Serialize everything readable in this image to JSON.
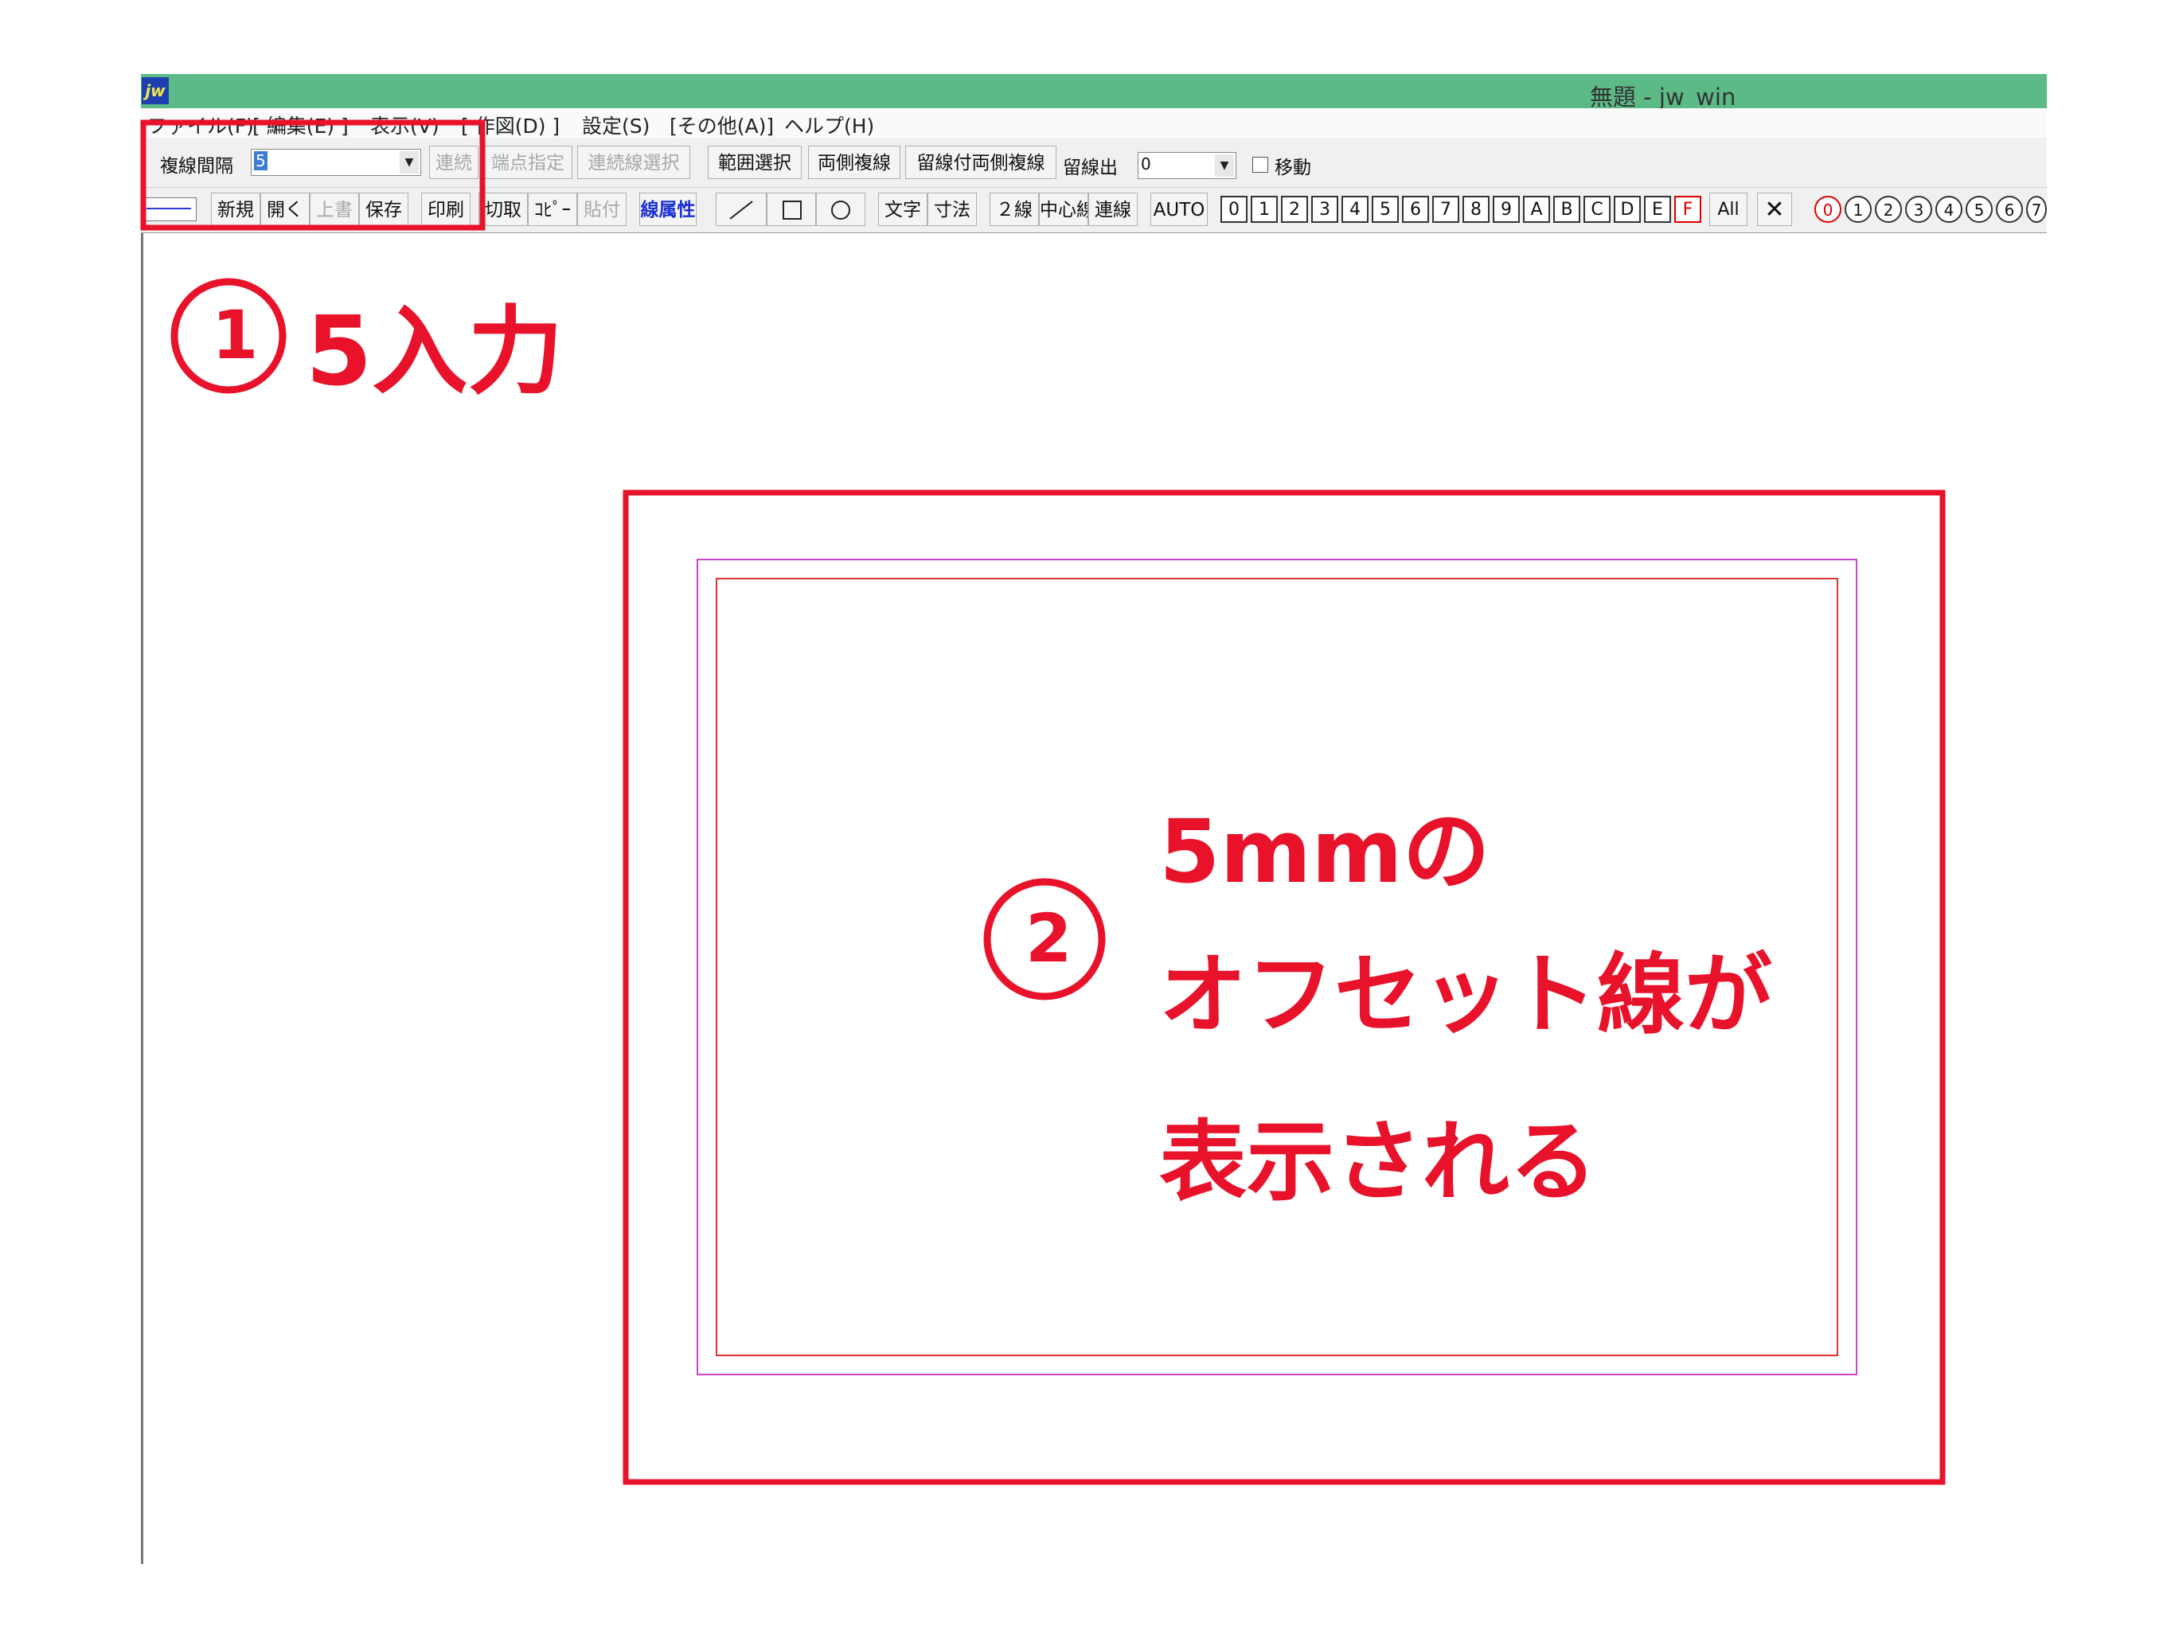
{
  "window": {
    "title": "無題 - jw_win",
    "icon_label": "jw"
  },
  "menu": [
    {
      "label": "ファイル(F)"
    },
    {
      "label": "[ 編集(E) ]"
    },
    {
      "label": "表示(V)"
    },
    {
      "label": "[ 作図(D) ]"
    },
    {
      "label": "設定(S)"
    },
    {
      "label": "[その他(A)]"
    },
    {
      "label": "ヘルプ(H)"
    }
  ],
  "toolbar1": {
    "interval_label": "複線間隔",
    "interval_value": "5",
    "buttons": {
      "renzoku": "連続",
      "tanten": "端点指定",
      "renzokusen": "連続線選択",
      "hanni": "範囲選択",
      "ryousoku": "両側複線",
      "tomesen_ryousoku": "留線付両側複線",
      "tomesen_label": "留線出",
      "tomesen_value": "0",
      "move_label": "移動"
    }
  },
  "toolbar2": {
    "buttons": {
      "new": "新規",
      "open": "開く",
      "overwrite": "上書",
      "save": "保存",
      "print": "印刷",
      "cut": "切取",
      "copy": "ｺﾋﾟｰ",
      "paste": "貼付",
      "line_attr": "線属性",
      "text": "文字",
      "dim": "寸法",
      "two_line": "２線",
      "center_line": "中心線",
      "chain_line": "連線",
      "auto": "AUTO"
    },
    "layers": [
      "0",
      "1",
      "2",
      "3",
      "4",
      "5",
      "6",
      "7",
      "8",
      "9",
      "A",
      "B",
      "C",
      "D",
      "E",
      "F"
    ],
    "all_label": "All",
    "groups": [
      "0",
      "1",
      "2",
      "3",
      "4",
      "5",
      "6",
      "7"
    ]
  },
  "annotations": {
    "step1_num": "1",
    "step1_text": "5入力",
    "step2_num": "2",
    "step2_line1": "5mmの",
    "step2_line2": "オフセット線が",
    "step2_line3": "表示される"
  },
  "colors": {
    "titlebar": "#5cba86",
    "annotation_red": "#e8122a",
    "offset_magenta": "#cc44cc",
    "inner_red": "#dd3333"
  }
}
